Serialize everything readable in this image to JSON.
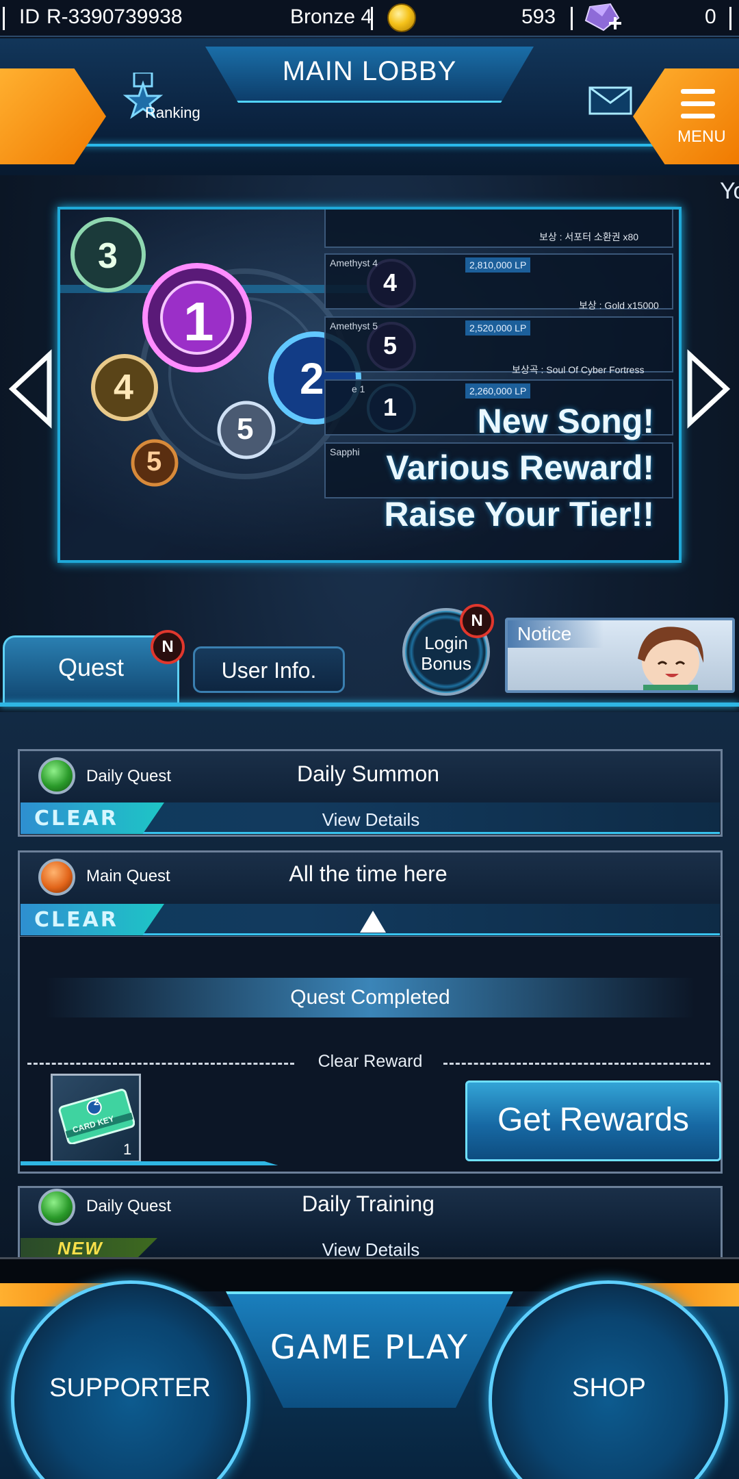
{
  "status_bar": {
    "id_label": "ID",
    "player_id": "R-3390739938",
    "tier": "Bronze 4",
    "gold": "593",
    "gems": "0"
  },
  "header": {
    "title": "MAIN LOBBY",
    "ranking_label": "Ranking",
    "menu_label": "MENU",
    "overflow_text": "Yo"
  },
  "banner": {
    "tier_rows": [
      {
        "name": "",
        "lp": "",
        "reward": "보상 : 서포터 소환권 x80"
      },
      {
        "name": "Amethyst 4",
        "lp": "2,810,000 LP",
        "reward": "보상 : Gold x15000"
      },
      {
        "name": "Amethyst 5",
        "lp": "2,520,000 LP",
        "reward": "보상곡 : Soul Of Cyber Fortress"
      },
      {
        "name": "e 1",
        "lp": "2,260,000 LP",
        "reward": ""
      },
      {
        "name": "Sapphi",
        "lp": "",
        "reward": ""
      }
    ],
    "medals": [
      "3",
      "1",
      "2",
      "4",
      "5",
      "5",
      "4",
      "5",
      "1"
    ],
    "lines": [
      "New Song!",
      "Various Reward!",
      "Raise Your Tier!!"
    ]
  },
  "tabs": {
    "quest": "Quest",
    "user_info": "User Info.",
    "badge": "N",
    "login_bonus_line1": "Login",
    "login_bonus_line2": "Bonus",
    "notice": "Notice"
  },
  "quests": [
    {
      "type": "Daily Quest",
      "title": "Daily Summon",
      "status": "CLEAR",
      "action": "View Details"
    },
    {
      "type": "Main Quest",
      "title": "All the time here",
      "status": "CLEAR",
      "action": ""
    },
    {
      "type": "Daily Quest",
      "title": "Daily Training",
      "status": "NEW",
      "action": "View Details"
    }
  ],
  "expanded": {
    "completed": "Quest Completed",
    "clear_reward": "Clear Reward",
    "item_label": "CARD KEY",
    "item_badge": "2",
    "item_count": "1",
    "get_rewards": "Get Rewards"
  },
  "bottom_nav": {
    "supporter": "SUPPORTER",
    "game_play": "GAME PLAY",
    "shop": "SHOP"
  },
  "colors": {
    "accent": "#2ab9ea",
    "orange": "#f5a020",
    "badge": "#e0372d"
  }
}
